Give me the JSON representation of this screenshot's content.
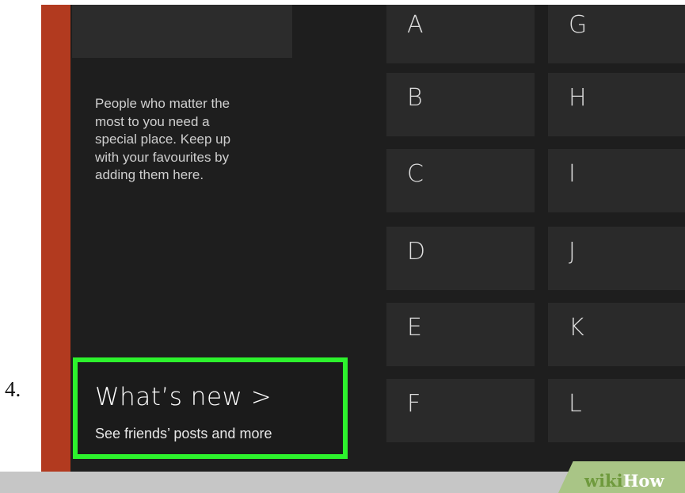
{
  "step": {
    "number": "4."
  },
  "favourites": {
    "description": "People who matter the\nmost to you need a\nspecial place. Keep up\nwith your favourites by\nadding them here."
  },
  "whats_new": {
    "title": "What’s new >",
    "subtitle": "See friends’ posts and more"
  },
  "alphabet": {
    "col1": [
      "A",
      "B",
      "C",
      "D",
      "E",
      "F"
    ],
    "col2": [
      "G",
      "H",
      "I",
      "J",
      "K",
      "L"
    ]
  },
  "watermark": {
    "wiki": "wiki",
    "how": "How"
  },
  "colors": {
    "accent": "#b23a1f",
    "highlight": "#2df22d",
    "background": "#1e1e1e",
    "tile": "#2a2a2a"
  }
}
